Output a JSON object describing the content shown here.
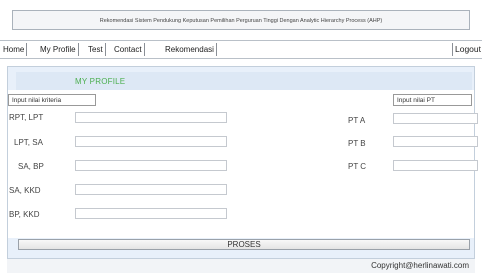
{
  "header": {
    "title": "Rekomendasi Sistem Pendukung Keputusan Pemilihan Perguruan Tinggi Dengan Analytic Hierarchy Process (AHP)"
  },
  "nav": {
    "items": [
      "Home",
      "My Profile",
      "Test",
      "Contact",
      "Rekomendasi"
    ],
    "logout": "Logout"
  },
  "profile": {
    "title": "MY PROFILE",
    "criteria_label": "Input nilai kriteria",
    "pt_label": "Input nilai PT",
    "criteria_rows": [
      {
        "label": "RPT, LPT",
        "value": ""
      },
      {
        "label": "LPT, SA",
        "value": ""
      },
      {
        "label": "SA, BP",
        "value": ""
      },
      {
        "label": "SA, KKD",
        "value": ""
      },
      {
        "label": "BP, KKD",
        "value": ""
      }
    ],
    "pt_rows": [
      {
        "label": "PT A",
        "value": ""
      },
      {
        "label": "PT B",
        "value": ""
      },
      {
        "label": "PT C",
        "value": ""
      }
    ],
    "submit_label": "PROSES"
  },
  "footer": {
    "copyright": "Copyright@herlinawati.com"
  }
}
